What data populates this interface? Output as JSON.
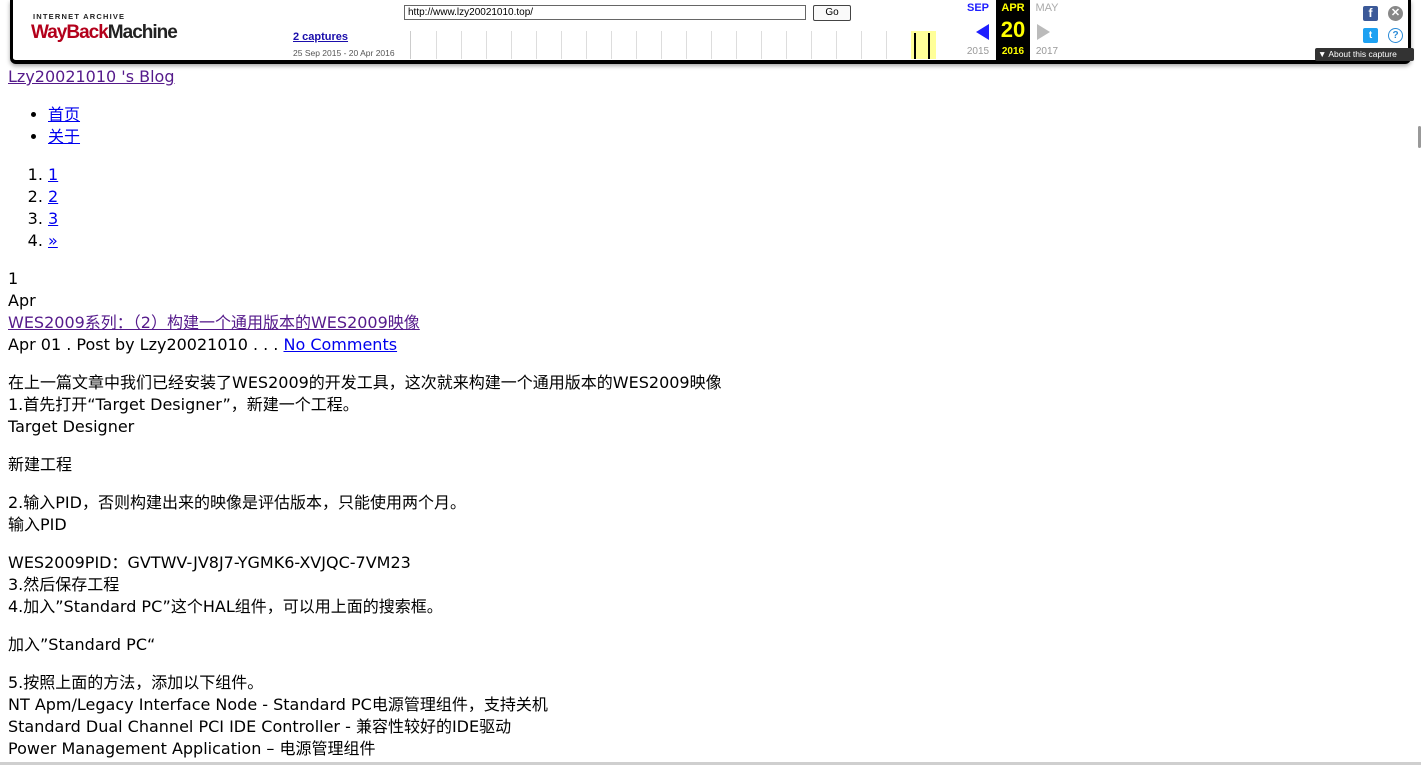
{
  "wayback": {
    "logo_top": "INTERNET ARCHIVE",
    "logo_main_1": "WayBack",
    "logo_main_2": "Machine",
    "url": "http://www.lzy20021010.top/",
    "go_label": "Go",
    "captures": "2 captures",
    "date_range": "25 Sep 2015 - 20 Apr 2016",
    "prev_month": "SEP",
    "cur_month": "APR",
    "next_month": "MAY",
    "cur_day": "20",
    "prev_year": "2015",
    "cur_year": "2016",
    "next_year": "2017",
    "about_label": "About this capture",
    "icons": [
      "wayback-logo",
      "facebook-icon",
      "twitter-icon",
      "close-icon",
      "help-icon",
      "prev-arrow-icon",
      "next-arrow-icon"
    ],
    "colors": {
      "accent_blue": "#1f1fff",
      "current_day": "#ffff00",
      "logo_red": "#b3001b"
    }
  },
  "blog": {
    "title": "Lzy20021010 's Blog",
    "nav": [
      "首页",
      "关于"
    ],
    "pages": [
      "1",
      "2",
      "3",
      "»"
    ]
  },
  "post": {
    "day": "1",
    "month": "Apr",
    "title": "WES2009系列：（2）构建一个通用版本的WES2009映像",
    "meta_prefix": "Apr 01 . Post by Lzy20021010 . . . ",
    "comments_link": "No Comments",
    "body": [
      [
        "在上一篇文章中我们已经安装了WES2009的开发工具，这次就来构建一个通用版本的WES2009映像",
        "1.首先打开“Target Designer”，新建一个工程。",
        "Target Designer"
      ],
      [
        "新建工程"
      ],
      [
        "2.输入PID，否则构建出来的映像是评估版本，只能使用两个月。",
        "输入PID"
      ],
      [
        "WES2009PID：GVTWV-JV8J7-YGMK6-XVJQC-7VM23",
        "3.然后保存工程",
        "4.加入”Standard PC”这个HAL组件，可以用上面的搜索框。"
      ],
      [
        "加入”Standard PC“"
      ],
      [
        "5.按照上面的方法，添加以下组件。",
        "NT Apm/Legacy Interface Node - Standard PC电源管理组件，支持关机",
        "Standard Dual Channel PCI IDE Controller - 兼容性较好的IDE驱动",
        "Power Management Application – 电源管理组件"
      ]
    ]
  }
}
